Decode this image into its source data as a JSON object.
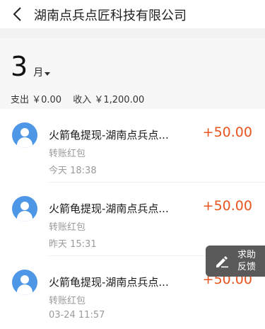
{
  "header": {
    "title": "湖南点兵点匠科技有限公司"
  },
  "summary": {
    "month": "3",
    "month_unit": "月",
    "expense": "支出 ￥0.00",
    "income": "收入 ￥1,200.00"
  },
  "transactions": [
    {
      "name": "火箭龟提现-湖南点兵点...",
      "type": "转账红包",
      "time": "今天  18:38",
      "amount": "+50.00"
    },
    {
      "name": "火箭龟提现-湖南点兵点...",
      "type": "转账红包",
      "time": "昨天  15:31",
      "amount": "+50.00"
    },
    {
      "name": "火箭龟提现-湖南点兵点...",
      "type": "转账红包",
      "time": "03-24  11:57",
      "amount": "+50.00"
    }
  ],
  "feedback": {
    "label_line1": "求助",
    "label_line2": "反馈"
  },
  "colors": {
    "accent": "#e8541e",
    "avatar": "#4d97e6"
  }
}
